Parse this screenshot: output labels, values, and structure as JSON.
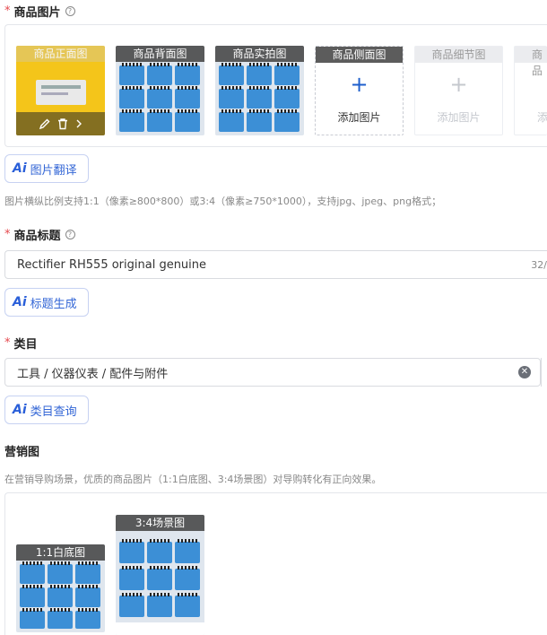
{
  "product_images": {
    "required_mark": "*",
    "label": "商品图片",
    "help_icon": "question-circle-icon",
    "slots": [
      {
        "caption": "商品正面图",
        "state": "filled",
        "image": "yellow-component-photo"
      },
      {
        "caption": "商品背面图",
        "state": "filled",
        "image": "blue-relays-photo"
      },
      {
        "caption": "商品实拍图",
        "state": "filled",
        "image": "blue-relays-photo"
      },
      {
        "caption": "商品侧面图",
        "state": "empty",
        "add_label": "添加图片"
      },
      {
        "caption": "商品细节图",
        "state": "disabled",
        "add_label": "添加图片"
      },
      {
        "caption": "商品",
        "state": "disabled",
        "add_label": "添"
      }
    ],
    "ai_button_logo": "Ai",
    "ai_button_label": "图片翻译",
    "hint": "图片横纵比例支持1:1（像素≥800*800）或3:4（像素≥750*1000），支持jpg、jpeg、png格式；"
  },
  "product_title": {
    "required_mark": "*",
    "label": "商品标题",
    "help_icon": "question-circle-icon",
    "value": "Rectifier RH555 original genuine",
    "counter": "32/",
    "ai_button_logo": "Ai",
    "ai_button_label": "标题生成"
  },
  "category": {
    "required_mark": "*",
    "label": "类目",
    "value": "工具 / 仪器仪表 / 配件与附件",
    "clear_icon": "close-circle-icon",
    "ai_button_logo": "Ai",
    "ai_button_label": "类目查询"
  },
  "marketing": {
    "label": "营销图",
    "hint": "在营销导购场景，优质的商品图片（1:1白底图、3:4场景图）对导购转化有正向效果。",
    "images": [
      {
        "caption": "1:1白底图",
        "image": "blue-relays-photo"
      },
      {
        "caption": "3:4场景图",
        "image": "blue-relays-photo"
      }
    ]
  },
  "colors": {
    "accent": "#1e5fcc",
    "required": "#e5484d",
    "ai_border": "#c7d2f2"
  }
}
